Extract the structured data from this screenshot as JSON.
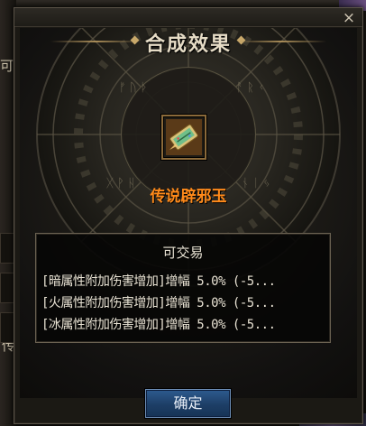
{
  "background": {
    "fragment_1": "可",
    "fragment_2": "型",
    "fragment_3": "传"
  },
  "dialog": {
    "title": "合成效果",
    "close_glyph": "×",
    "item": {
      "name": "传说辟邪玉",
      "icon": "jade-charm-icon",
      "name_color": "#ff8a1a"
    },
    "info": {
      "header": "可交易",
      "lines": [
        "[暗属性附加伤害增加]增幅 5.0% (-5...",
        "[火属性附加伤害增加]增幅 5.0% (-5...",
        "[冰属性附加伤害增加]增幅 5.0% (-5..."
      ]
    },
    "confirm_label": "确定"
  },
  "colors": {
    "accent_gold": "#a88b57",
    "button_blue": "#2d5b8f"
  }
}
